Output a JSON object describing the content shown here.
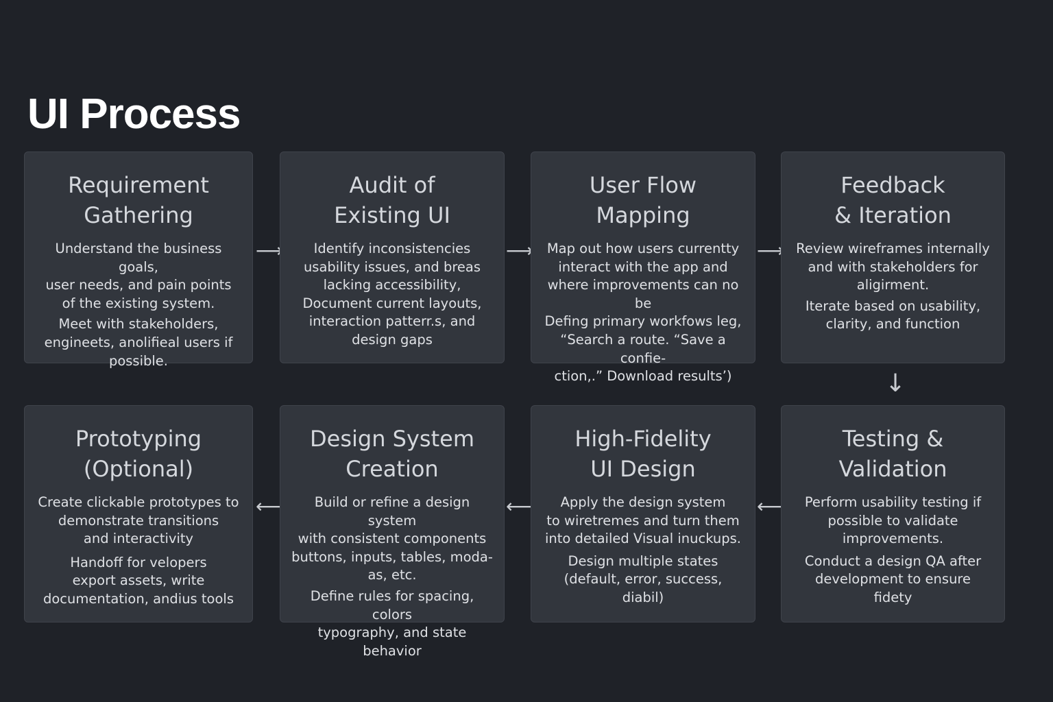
{
  "title": "UI Process",
  "steps": [
    {
      "title": "Requirement\nGathering",
      "paragraphs": [
        "Understand the business goals,\n user needs, and pain points\nof the existing system.",
        "  Meet with stakeholders,\nengineets, anolifieal users if\n possible."
      ]
    },
    {
      "title": "Audit of\nExisting UI",
      "paragraphs": [
        "Identify inconsistencies\nusability issues, and breas\nlacking accessibility,\nDocument current layouts,\ninteraction patterr.s, and\ndesign gaps"
      ]
    },
    {
      "title": "User Flow\nMapping",
      "paragraphs": [
        "Map out how users currentty\ninteract with the app and\nwhere improvements can no be\nDefing primary workfows leg,\n“Search a route. “Save a confie-\nction,.” Download results’)"
      ]
    },
    {
      "title": "Feedback\n& Iteration",
      "paragraphs": [
        "Review wireframes internally\nand with stakeholders for\naligirment.",
        "Iterate based on usability,\nclarity, and function"
      ]
    },
    {
      "title": "Prototyping\n(Optional)",
      "paragraphs": [
        "Create clickable prototypes to\ndemonstrate transitions\nand interactivity",
        "Handoff for velopers\nexport assets, write\ndocumentation, andius tools"
      ]
    },
    {
      "title": "Design System\nCreation",
      "paragraphs": [
        "Build or refine a design system\nwith consistent components\n buttons, inputs, tables, moda-\nas, etc.",
        "Define rules for spacing, colors\ntypography, and state behavior"
      ]
    },
    {
      "title": "High-Fidelity\nUI Design",
      "paragraphs": [
        "Apply the design system\nto wiretremes and turn them\ninto detailed Visual inuckups.",
        "Design multiple states\n(default, error, success, diabil)"
      ]
    },
    {
      "title": "Testing &\nValidation",
      "paragraphs": [
        "Perform usability testing if\npossible to validate\nimprovements.",
        "Conduct a design QA after\ndevelopment to ensure fidety"
      ]
    }
  ],
  "arrows": {
    "right": "⟶",
    "left": "⟵",
    "down": "↓"
  }
}
